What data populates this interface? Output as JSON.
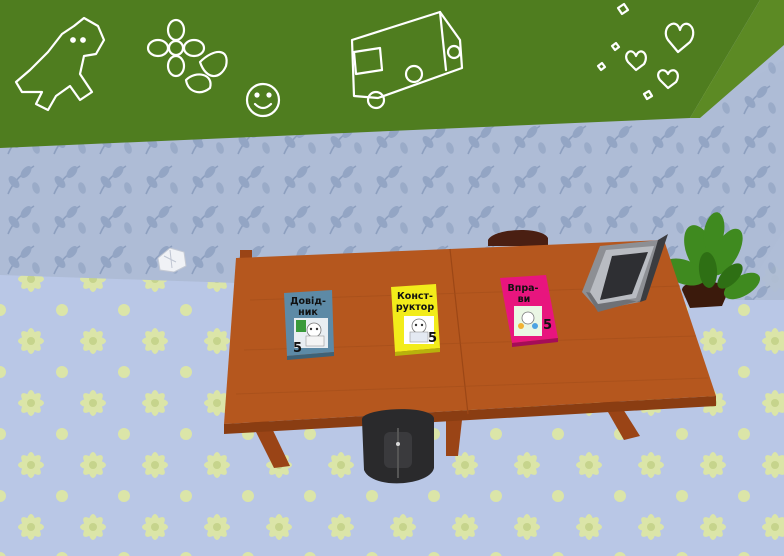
{
  "scene": {
    "wall_top_color": "#4f7d1f",
    "wallpaper_color": "#a9b9d4",
    "floor_color": "#b7c6e6",
    "flower_color": "#d9e4a4",
    "desk_color": "#b5571e"
  },
  "books": [
    {
      "title_line1": "Довід-",
      "title_line2": "ник",
      "grade": "5",
      "cover_color": "#5d8aa6",
      "cover_art": "grandpa-with-plant"
    },
    {
      "title_line1": "Конст-",
      "title_line2": "руктор",
      "grade": "5",
      "cover_color": "#f2ec1a",
      "cover_art": "grandpa-character"
    },
    {
      "title_line1": "Впра-",
      "title_line2": "ви",
      "grade": "5",
      "cover_color": "#e8157e",
      "cover_art": "grandpa-with-kids"
    }
  ],
  "objects": {
    "laptop": "laptop",
    "plant": "potted-plant",
    "chair": "chair",
    "backpack": "backpack",
    "paper": "crumpled-paper"
  },
  "doodles": [
    "llama-icon",
    "flower-icon",
    "smiley-icon",
    "bus-icon",
    "hearts-icon"
  ]
}
